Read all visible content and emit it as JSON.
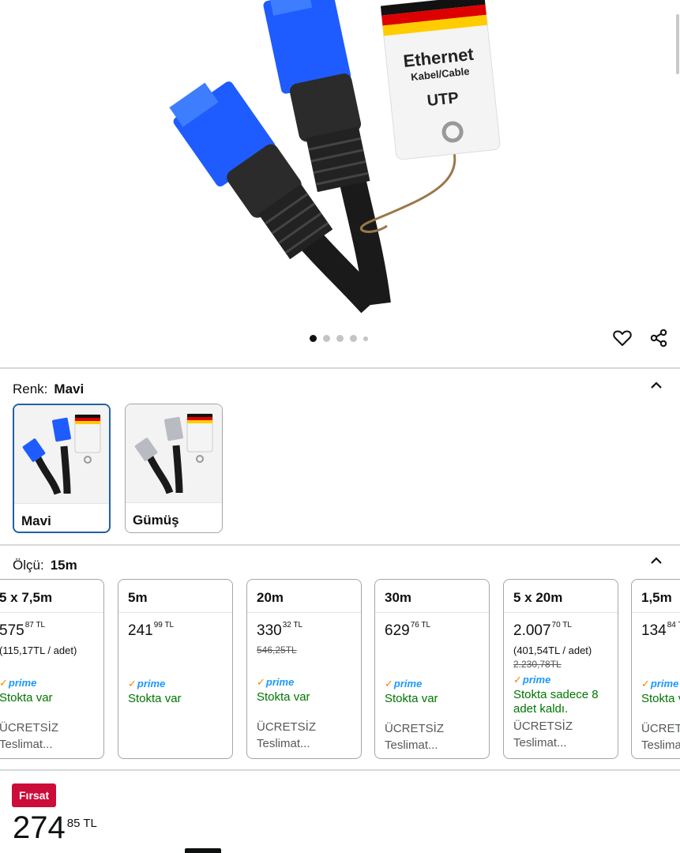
{
  "gallery": {
    "tag_title": "Ethernet",
    "tag_subtitle": "Kabel/Cable",
    "tag_type": "UTP",
    "dot_count": 5
  },
  "actions": {
    "favorite": "heart-icon",
    "share": "share-icon"
  },
  "color_section": {
    "label": "Renk:",
    "selected": "Mavi",
    "options": [
      {
        "name": "Mavi",
        "selected": true
      },
      {
        "name": "Gümüş",
        "selected": false
      }
    ]
  },
  "size_section": {
    "label": "Ölçü:",
    "selected": "15m",
    "options": [
      {
        "title": "5 x 7,5m",
        "price_main": "575",
        "price_frac": "87",
        "currency": "TL",
        "unit_price": "(115,17TL / adet)",
        "list_price": "",
        "prime": "prime",
        "stock": "Stokta var",
        "delivery": "ÜCRETSİZ",
        "delivery2": "Teslimat..."
      },
      {
        "title": "5m",
        "price_main": "241",
        "price_frac": "99",
        "currency": "TL",
        "unit_price": "",
        "list_price": "",
        "prime": "prime",
        "stock": "Stokta var",
        "delivery": "",
        "delivery2": ""
      },
      {
        "title": "20m",
        "price_main": "330",
        "price_frac": "32",
        "currency": "TL",
        "unit_price": "",
        "list_price": "546,25TL",
        "prime": "prime",
        "stock": "Stokta var",
        "delivery": "ÜCRETSİZ",
        "delivery2": "Teslimat..."
      },
      {
        "title": "30m",
        "price_main": "629",
        "price_frac": "76",
        "currency": "TL",
        "unit_price": "",
        "list_price": "",
        "prime": "prime",
        "stock": "Stokta var",
        "delivery": "ÜCRETSİZ",
        "delivery2": "Teslimat..."
      },
      {
        "title": "5 x 20m",
        "price_main": "2.007",
        "price_frac": "70",
        "currency": "TL",
        "unit_price": "(401,54TL / adet)",
        "list_price": "2.230,78TL",
        "prime": "prime",
        "stock": "Stokta sadece 8 adet kaldı.",
        "delivery": "ÜCRETSİZ",
        "delivery2": "Teslimat..."
      },
      {
        "title": "1,5m",
        "price_main": "134",
        "price_frac": "84",
        "currency": "TL",
        "unit_price": "",
        "list_price": "",
        "prime": "prime",
        "stock": "Stokta var",
        "delivery": "ÜCRETSİZ",
        "delivery2": "Teslimat..."
      }
    ]
  },
  "deal_badge": "Fırsat",
  "price": {
    "main": "274",
    "frac": "85",
    "currency": "TL"
  },
  "colors": {
    "deal_red": "#cc0c39",
    "stock_green": "#007600",
    "selected_border": "#2162a1",
    "prime_blue": "#1a98ff"
  }
}
